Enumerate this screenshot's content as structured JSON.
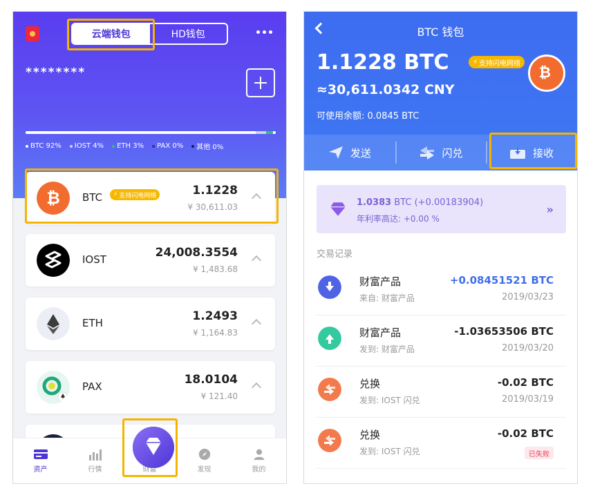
{
  "left": {
    "wallet_tabs": [
      "云端钱包",
      "HD钱包"
    ],
    "masked_balance": "********",
    "distribution": [
      {
        "label": "BTC 92%",
        "value": 92,
        "color": "#ffffff"
      },
      {
        "label": "IOST 4%",
        "value": 4,
        "color": "#cfd3e8"
      },
      {
        "label": "ETH 3%",
        "value": 3,
        "color": "#2ec27e"
      },
      {
        "label": "PAX 0%",
        "value": 0,
        "color": "#3a2b9e"
      },
      {
        "label": "其他 0%",
        "value": 0,
        "color": "#1a1a55"
      }
    ],
    "assets": [
      {
        "name": "BTC",
        "badge": "支持闪电网络",
        "amount": "1.1228",
        "fiat": "¥ 30,611.03"
      },
      {
        "name": "IOST",
        "amount": "24,008.3554",
        "fiat": "¥ 1,483.68"
      },
      {
        "name": "ETH",
        "amount": "1.2493",
        "fiat": "¥ 1,164.83"
      },
      {
        "name": "PAX",
        "amount": "18.0104",
        "fiat": "¥ 121.40"
      }
    ],
    "tabbar": [
      "资产",
      "行情",
      "财富",
      "发现",
      "我的"
    ]
  },
  "right": {
    "title": "BTC 钱包",
    "balance": "1.1228 BTC",
    "badge": "支持闪电网络",
    "cny": "≈30,611.0342 CNY",
    "available": "可使用余额: 0.0845 BTC",
    "actions": [
      "发送",
      "闪兑",
      "接收"
    ],
    "promo": {
      "amount": "1.0383",
      "unit": " BTC (+0.00183904)",
      "rate": "年利率高达: +0.00 %"
    },
    "tx_heading": "交易记录",
    "transactions": [
      {
        "title": "财富产品",
        "sub": "来自: 财富产品",
        "amount": "+0.08451521 BTC",
        "date": "2019/03/23"
      },
      {
        "title": "财富产品",
        "sub": "发到: 财富产品",
        "amount": "-1.03653506 BTC",
        "date": "2019/03/20"
      },
      {
        "title": "兑换",
        "sub": "发到: IOST 闪兑",
        "amount": "-0.02 BTC",
        "date": "2019/03/19"
      },
      {
        "title": "兑换",
        "sub": "发到: IOST 闪兑",
        "amount": "-0.02 BTC",
        "status": "已失败"
      }
    ]
  },
  "colors": {
    "primary": "#5a3df0",
    "accent": "#3f78f3",
    "highlight": "#f5b400",
    "btc": "#f26b2f",
    "lightning": "#f7b800"
  }
}
